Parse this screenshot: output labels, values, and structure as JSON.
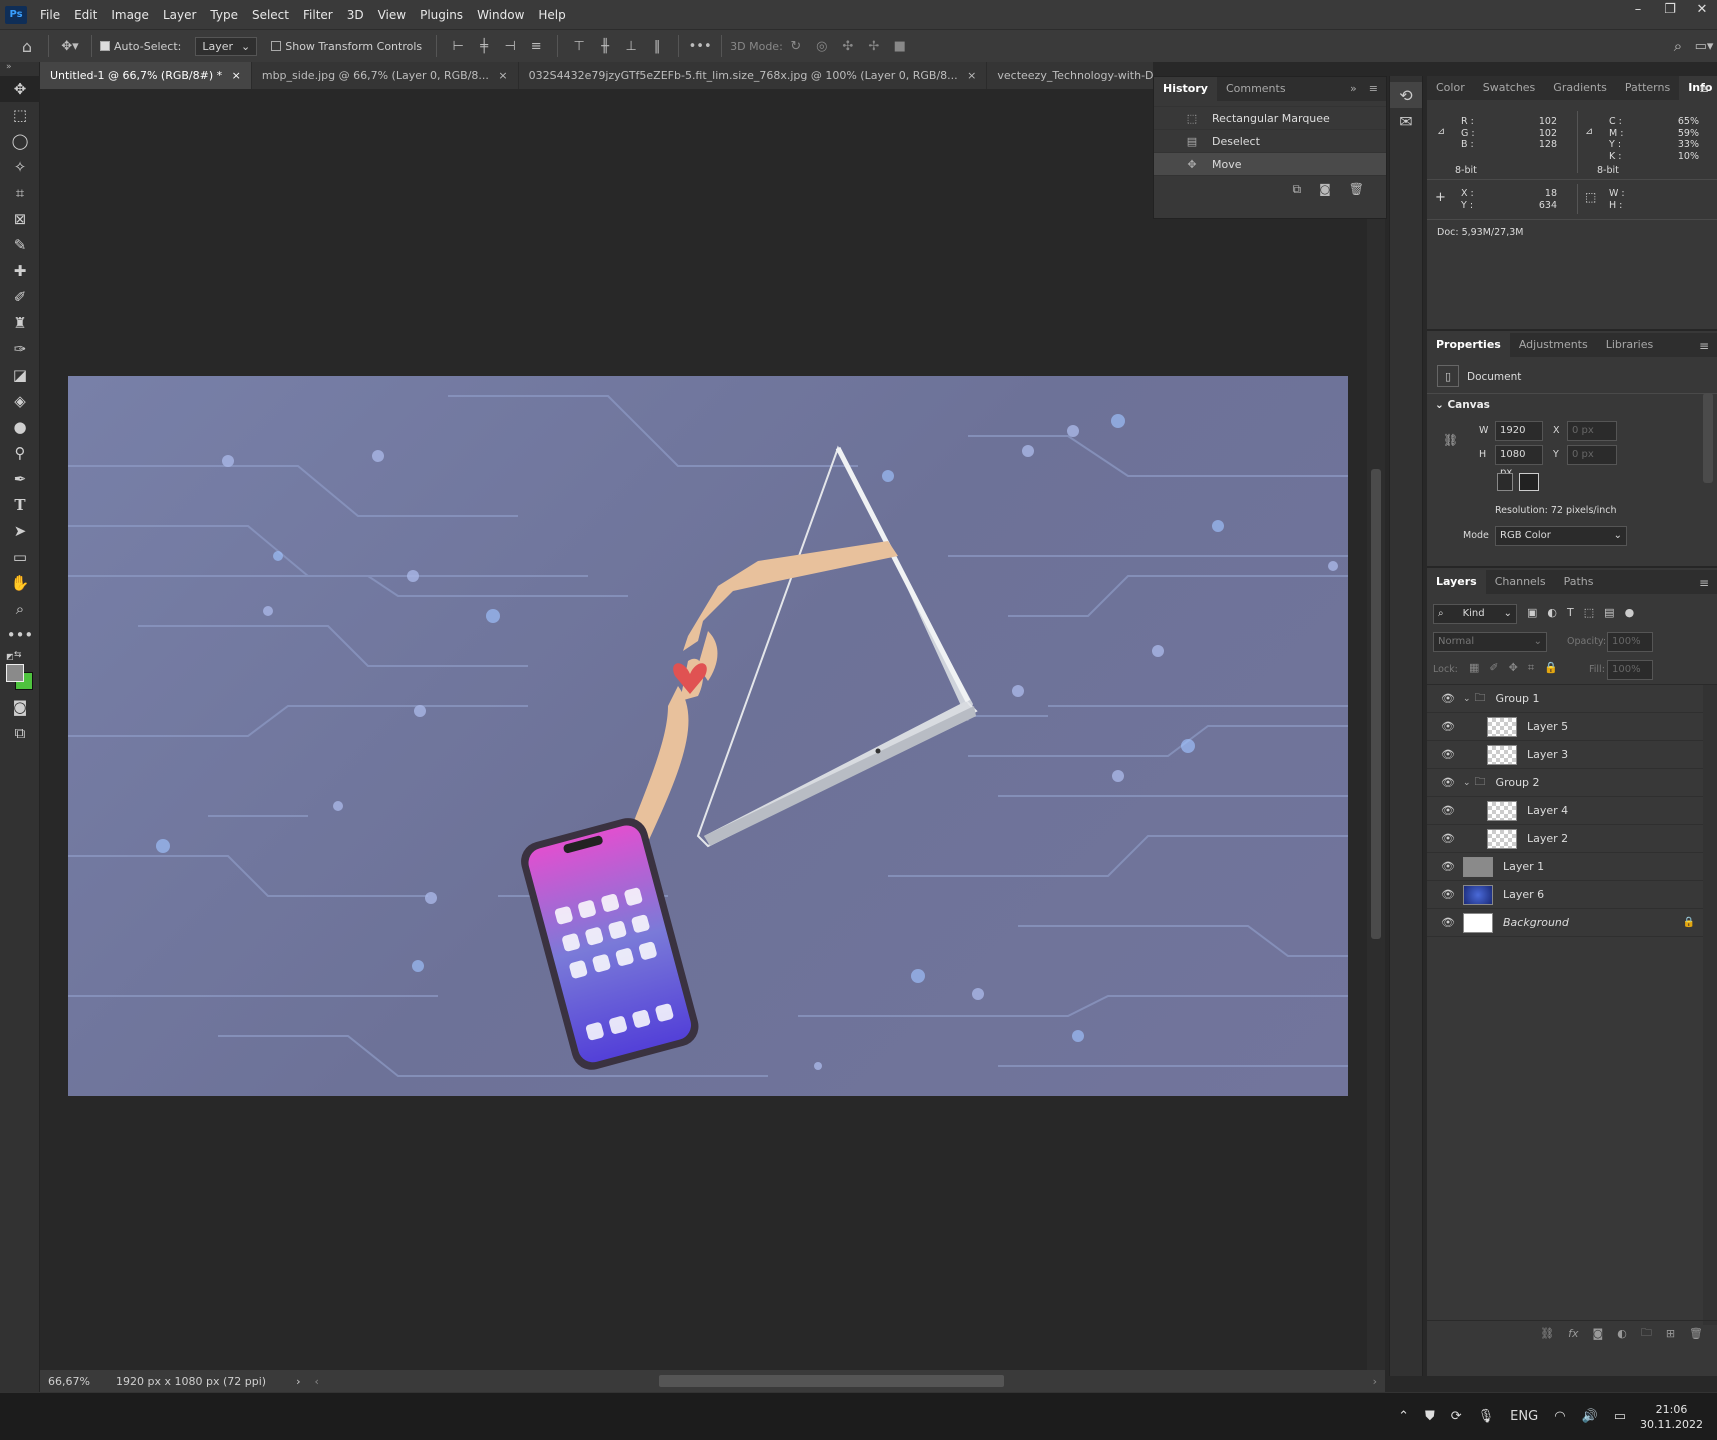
{
  "app": {
    "logo": "Ps"
  },
  "menu": [
    "File",
    "Edit",
    "Image",
    "Layer",
    "Type",
    "Select",
    "Filter",
    "3D",
    "View",
    "Plugins",
    "Window",
    "Help"
  ],
  "window_controls": {
    "minimize": "–",
    "maximize": "❐",
    "close": "✕"
  },
  "options": {
    "auto_select_label": "Auto-Select:",
    "auto_select_value": "Layer",
    "show_transform_label": "Show Transform Controls",
    "mode_3d_label": "3D Mode:",
    "more": "•••"
  },
  "tabs": [
    {
      "label": "Untitled-1 @ 66,7% (RGB/8#) *",
      "close": "×"
    },
    {
      "label": "mbp_side.jpg @ 66,7% (Layer 0, RGB/8...",
      "close": "×"
    },
    {
      "label": "032S4432e79jzyGTf5eZEFb-5.fit_lim.size_768x.jpg @ 100% (Layer 0, RGB/8...",
      "close": "×"
    },
    {
      "label": "vecteezy_Technology-with-Dark-Blue-Backg",
      "close": ""
    }
  ],
  "history": {
    "tabs": [
      "History",
      "Comments"
    ],
    "items": [
      {
        "label": "Rectangular Marquee",
        "icon": "rect-marquee-icon"
      },
      {
        "label": "Deselect",
        "icon": "document-icon"
      },
      {
        "label": "Move",
        "icon": "move-icon",
        "selected": true
      }
    ]
  },
  "info": {
    "tabs": [
      "Color",
      "Swatches",
      "Gradients",
      "Patterns",
      "Info"
    ],
    "rgb": {
      "r_label": "R :",
      "g_label": "G :",
      "b_label": "B :",
      "r": "102",
      "g": "102",
      "b": "128",
      "bit": "8-bit"
    },
    "cmyk": {
      "c_label": "C :",
      "m_label": "M :",
      "y_label": "Y :",
      "k_label": "K :",
      "c": "65%",
      "m": "59%",
      "y": "33%",
      "k": "10%",
      "bit": "8-bit"
    },
    "xy": {
      "x_label": "X :",
      "y_label": "Y :",
      "x": "18",
      "y": "634"
    },
    "wh": {
      "w_label": "W :",
      "h_label": "H :"
    },
    "doc": "Doc: 5,93M/27,3M"
  },
  "properties": {
    "tabs": [
      "Properties",
      "Adjustments",
      "Libraries"
    ],
    "document_label": "Document",
    "canvas_label": "Canvas",
    "w_label": "W",
    "w": "1920 px",
    "h_label": "H",
    "h": "1080 px",
    "x_label": "X",
    "x_placeholder": "0 px",
    "y_label": "Y",
    "y_placeholder": "0 px",
    "resolution": "Resolution: 72 pixels/inch",
    "mode_label": "Mode",
    "mode_value": "RGB Color"
  },
  "layers": {
    "tabs": [
      "Layers",
      "Channels",
      "Paths"
    ],
    "kind": "Kind",
    "blend": "Normal",
    "opacity_label": "Opacity:",
    "opacity": "100%",
    "lock_label": "Lock:",
    "fill_label": "Fill:",
    "fill": "100%",
    "items": [
      {
        "name": "Group 1",
        "type": "group"
      },
      {
        "name": "Layer 5",
        "type": "child"
      },
      {
        "name": "Layer 3",
        "type": "child"
      },
      {
        "name": "Group 2",
        "type": "group"
      },
      {
        "name": "Layer 4",
        "type": "child"
      },
      {
        "name": "Layer 2",
        "type": "child"
      },
      {
        "name": "Layer 1",
        "type": "gray"
      },
      {
        "name": "Layer 6",
        "type": "blue"
      },
      {
        "name": "Background",
        "type": "white",
        "locked": true
      }
    ]
  },
  "status": {
    "zoom": "66,67%",
    "doc_info": "1920 px x 1080 px (72 ppi)"
  },
  "taskbar": {
    "lang": "ENG",
    "time": "21:06",
    "date": "30.11.2022"
  },
  "colors": {
    "fg": "#8a8a8a",
    "bg": "#4ec33e"
  }
}
